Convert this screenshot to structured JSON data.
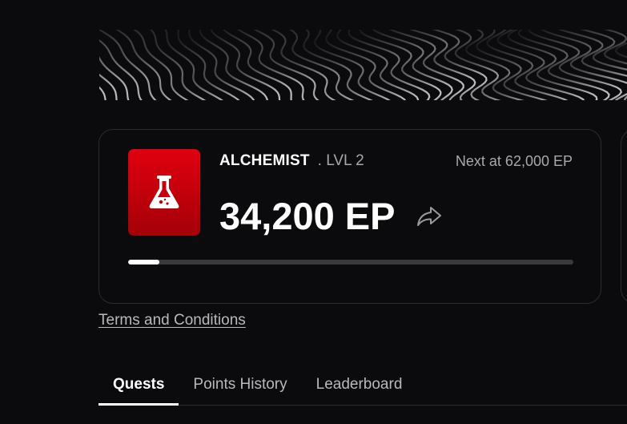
{
  "banner": {
    "pattern_icon": "wavy-contour-pattern",
    "line_color": "#c9c9cc"
  },
  "tier": {
    "name": "ALCHEMIST",
    "level": ". LVL 2",
    "next_at": "Next at 62,000 EP",
    "points": "34,200 EP",
    "badge_icon": "flask-icon",
    "badge_color": "#d4000d",
    "share_icon": "share-icon",
    "progress_fraction": 0.07
  },
  "terms_link": "Terms and Conditions",
  "tabs": [
    {
      "label": "Quests",
      "active": true
    },
    {
      "label": "Points History",
      "active": false
    },
    {
      "label": "Leaderboard",
      "active": false
    }
  ]
}
